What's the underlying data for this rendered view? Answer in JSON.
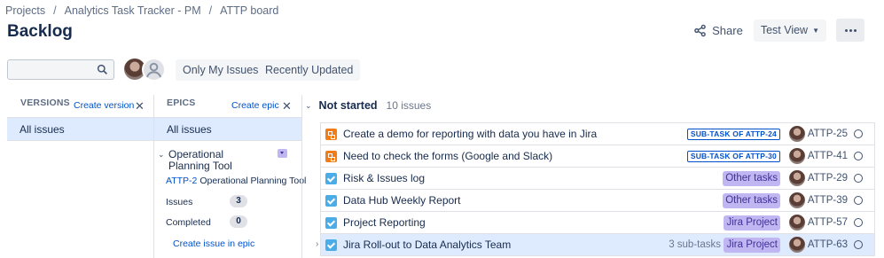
{
  "breadcrumb": [
    "Projects",
    "Analytics Task Tracker - PM",
    "ATTP board"
  ],
  "page_title": "Backlog",
  "toolbar": {
    "share_label": "Share",
    "view_label": "Test View",
    "more_icon": "more-icon"
  },
  "search": {
    "value": "",
    "placeholder": ""
  },
  "quick_filters": [
    "Only My Issues",
    "Recently Updated"
  ],
  "versions_panel": {
    "header": "VERSIONS",
    "create_label": "Create version",
    "all_label": "All issues"
  },
  "epics_panel": {
    "header": "EPICS",
    "create_label": "Create epic",
    "all_label": "All issues",
    "epic": {
      "name": "Operational Planning Tool",
      "key": "ATTP-2",
      "key_title": "Operational Planning Tool",
      "issues_label": "Issues",
      "issues_count": "3",
      "completed_label": "Completed",
      "completed_count": "0",
      "create_issue_label": "Create issue in epic",
      "color": "#c0b6f2"
    }
  },
  "sprint": {
    "name": "Not started",
    "count_label": "10 issues"
  },
  "issues": [
    {
      "type": "subtask",
      "summary": "Create a demo for reporting with data you have in Jira",
      "parent": "SUB-TASK OF ATTP-24",
      "epic": "",
      "subtasks": "",
      "key": "ATTP-25",
      "selected": false
    },
    {
      "type": "subtask",
      "summary": "Need to check the forms (Google and Slack)",
      "parent": "SUB-TASK OF ATTP-30",
      "epic": "",
      "subtasks": "",
      "key": "ATTP-41",
      "selected": false
    },
    {
      "type": "task",
      "summary": "Risk & Issues log",
      "parent": "",
      "epic": "Other tasks",
      "subtasks": "",
      "key": "ATTP-29",
      "selected": false
    },
    {
      "type": "task",
      "summary": "Data Hub Weekly Report",
      "parent": "",
      "epic": "Other tasks",
      "subtasks": "",
      "key": "ATTP-39",
      "selected": false
    },
    {
      "type": "task",
      "summary": "Project Reporting",
      "parent": "",
      "epic": "Jira Project",
      "subtasks": "",
      "key": "ATTP-57",
      "selected": false
    },
    {
      "type": "task",
      "summary": "Jira Roll-out to Data Analytics Team",
      "parent": "",
      "epic": "Jira Project",
      "subtasks": "3 sub-tasks",
      "key": "ATTP-63",
      "selected": true
    }
  ],
  "colors": {
    "accent": "#0052cc",
    "selected": "#deebff",
    "epic_lozenge": "#c0b6f2",
    "subtask_icon": "#f07d18",
    "task_icon": "#4bade8"
  }
}
